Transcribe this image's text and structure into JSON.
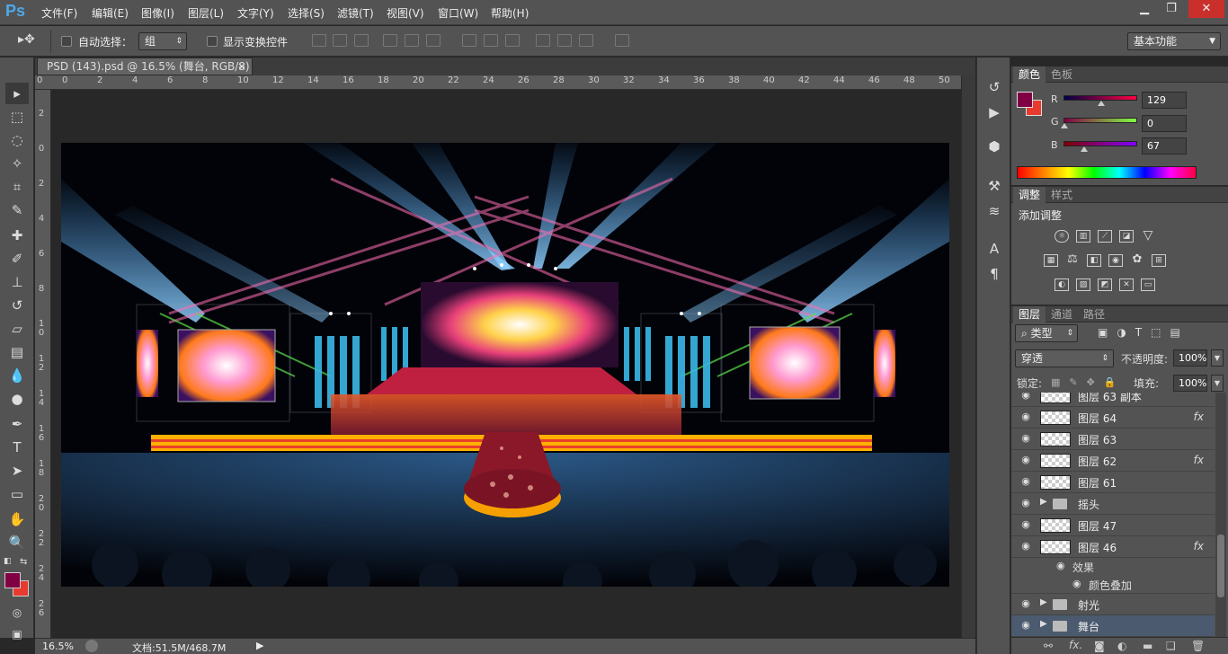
{
  "app": {
    "logo": "Ps"
  },
  "menu": [
    "文件(F)",
    "编辑(E)",
    "图像(I)",
    "图层(L)",
    "文字(Y)",
    "选择(S)",
    "滤镜(T)",
    "视图(V)",
    "窗口(W)",
    "帮助(H)"
  ],
  "window_controls": {
    "minimize": "▁",
    "restore": "❐",
    "close": "✕"
  },
  "options": {
    "auto_select_label": "自动选择：",
    "auto_select_value": "组",
    "show_transform_label": "显示变换控件",
    "workspace": "基本功能"
  },
  "document": {
    "tab_title": "PSD (143).psd @ 16.5% (舞台, RGB/8)",
    "close": "×"
  },
  "ruler": {
    "h": [
      "0",
      "0",
      "2",
      "4",
      "6",
      "8",
      "10",
      "12",
      "14",
      "16",
      "18",
      "20",
      "22",
      "24",
      "26",
      "28",
      "30",
      "32",
      "34",
      "36",
      "38",
      "40",
      "42",
      "44",
      "46",
      "48",
      "50"
    ],
    "v": [
      "2",
      "0",
      "2",
      "4",
      "6",
      "8",
      "1 0",
      "1 2",
      "1 4",
      "1 6",
      "1 8",
      "2 0",
      "2 2",
      "2 4",
      "2 6"
    ]
  },
  "status": {
    "zoom": "16.5%",
    "doc_info": "文档:51.5M/468.7M"
  },
  "color_panel": {
    "tabs": [
      "颜色",
      "色板"
    ],
    "channels": [
      {
        "label": "R",
        "value": "129",
        "level": 0.506
      },
      {
        "label": "G",
        "value": "0",
        "level": 0.0
      },
      {
        "label": "B",
        "value": "67",
        "level": 0.263
      }
    ],
    "foreground": "#810043",
    "background": "#e83a2e"
  },
  "adjust_panel": {
    "tabs": [
      "调整",
      "样式"
    ],
    "title": "添加调整",
    "icons_row1": [
      "brightness-icon",
      "levels-icon",
      "curves-icon",
      "exposure-icon",
      "vibrance-icon"
    ],
    "icons_row2": [
      "hue-saturation-icon",
      "color-balance-icon",
      "black-white-icon",
      "photo-filter-icon",
      "channel-mixer-icon",
      "color-lookup-icon"
    ],
    "icons_row3": [
      "invert-icon",
      "posterize-icon",
      "threshold-icon",
      "selective-color-icon",
      "gradient-map-icon"
    ]
  },
  "layers_panel": {
    "tabs": [
      "图层",
      "通道",
      "路径"
    ],
    "filter_label": "类型",
    "blend_mode": "穿透",
    "opacity_label": "不透明度:",
    "opacity_value": "100%",
    "lock_label": "锁定:",
    "fill_label": "填充:",
    "fill_value": "100%",
    "layers": [
      {
        "name": "图层 63 副本",
        "fx": false,
        "kind": "layer"
      },
      {
        "name": "图层 64",
        "fx": true,
        "kind": "layer"
      },
      {
        "name": "图层 63",
        "fx": false,
        "kind": "layer"
      },
      {
        "name": "图层 62",
        "fx": true,
        "kind": "layer"
      },
      {
        "name": "图层 61",
        "fx": false,
        "kind": "layer"
      },
      {
        "name": "摇头",
        "fx": false,
        "kind": "group"
      },
      {
        "name": "图层 47",
        "fx": false,
        "kind": "layer"
      },
      {
        "name": "图层 46",
        "fx": true,
        "kind": "layer"
      }
    ],
    "effects_label": "效果",
    "effect_item": "颜色叠加",
    "groups_bottom": [
      {
        "name": "射光",
        "selected": false
      },
      {
        "name": "舞台",
        "selected": true
      }
    ],
    "fx_symbol": "fx"
  }
}
